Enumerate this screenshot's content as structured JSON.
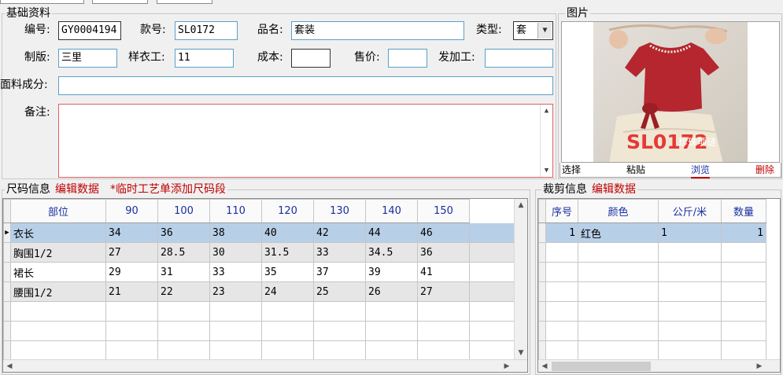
{
  "basic": {
    "legend": "基础资料",
    "code_label": "编号:",
    "code_value": "GY0004194",
    "style_label": "款号:",
    "style_value": "SL0172",
    "name_label": "品名:",
    "name_value": "套装",
    "type_label": "类型:",
    "type_value": "套",
    "pattern_label": "制版:",
    "pattern_value": "三里",
    "sample_label": "样衣工:",
    "sample_value": "11",
    "cost_label": "成本:",
    "cost_value": "",
    "price_label": "售价:",
    "price_value": "",
    "process_label": "发加工:",
    "process_value": "",
    "fabric_label": "面料成分:",
    "fabric_value": "",
    "remark_label": "备注:",
    "remark_value": ""
  },
  "image_panel": {
    "legend": "图片",
    "overlay_text": "SL0172",
    "overlay_small": "珍珠项链",
    "select_label": "选择",
    "paste_label": "粘贴",
    "browse_label": "浏览",
    "delete_label": "删除"
  },
  "size_section": {
    "legend": "尺码信息",
    "edit_label": "编辑数据",
    "note_label": "*临时工艺单添加尺码段",
    "columns": [
      "部位",
      "90",
      "100",
      "110",
      "120",
      "130",
      "140",
      "150"
    ],
    "rows": [
      [
        "衣长",
        "34",
        "36",
        "38",
        "40",
        "42",
        "44",
        "46"
      ],
      [
        "胸围1/2",
        "27",
        "28.5",
        "30",
        "31.5",
        "33",
        "34.5",
        "36"
      ],
      [
        "裙长",
        "29",
        "31",
        "33",
        "35",
        "37",
        "39",
        "41"
      ],
      [
        "腰围1/2",
        "21",
        "22",
        "23",
        "24",
        "25",
        "26",
        "27"
      ]
    ]
  },
  "cut_section": {
    "legend": "裁剪信息",
    "edit_label": "编辑数据",
    "columns": [
      "序号",
      "颜色",
      "公斤/米",
      "数量"
    ],
    "rows": [
      [
        "1",
        "红色",
        "1",
        "1"
      ]
    ]
  }
}
